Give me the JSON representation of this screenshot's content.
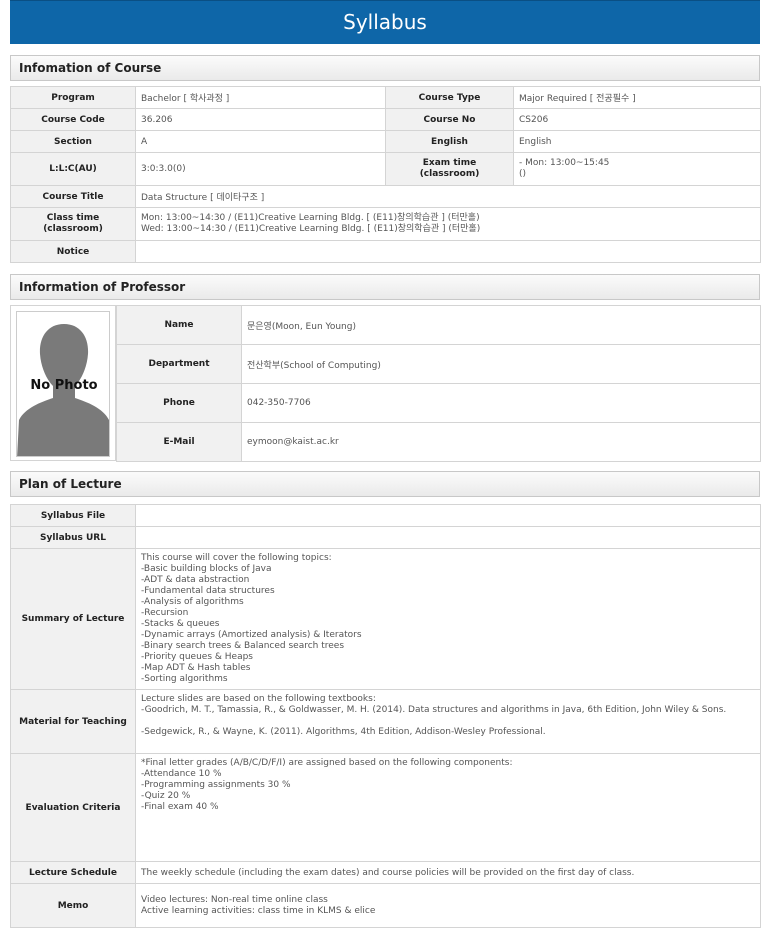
{
  "page": {
    "title": "Syllabus"
  },
  "course": {
    "heading": "Infomation of Course",
    "program_label": "Program",
    "program_value": "Bachelor [ 학사과정 ]",
    "course_type_label": "Course Type",
    "course_type_value": "Major Required [ 전공필수 ]",
    "course_code_label": "Course Code",
    "course_code_value": "36.206",
    "course_no_label": "Course No",
    "course_no_value": "CS206",
    "section_label": "Section",
    "section_value": "A",
    "english_label": "English",
    "english_value": "English",
    "lecture_label": "L:L:C(AU)",
    "lecture_value": "3:0:3.0(0)",
    "exam_label": "Exam time\n(classroom)",
    "exam_value": "- Mon: 13:00~15:45\n()",
    "course_title_label": "Course Title",
    "course_title_value": "Data Structure [ 데이타구조 ]",
    "class_time_label": "Class time\n(classroom)",
    "class_time_value": "Mon: 13:00~14:30 / (E11)Creative Learning Bldg. [ (E11)창의학습관 ] (터만홀)\nWed: 13:00~14:30 / (E11)Creative Learning Bldg. [ (E11)창의학습관 ] (터만홀)",
    "notice_label": "Notice",
    "notice_value": ""
  },
  "professor": {
    "heading": "Information of Professor",
    "photo_text": "No Photo",
    "name_label": "Name",
    "name_value": "문은영(Moon, Eun Young)",
    "department_label": "Department",
    "department_value": "전산학부(School of Computing)",
    "phone_label": "Phone",
    "phone_value": "042-350-7706",
    "email_label": "E-Mail",
    "email_value": "eymoon@kaist.ac.kr"
  },
  "plan": {
    "heading": "Plan of Lecture",
    "syllabus_file_label": "Syllabus File",
    "syllabus_file_value": "",
    "syllabus_url_label": "Syllabus URL",
    "syllabus_url_value": "",
    "summary_label": "Summary of Lecture",
    "summary_value": "This course will cover the following topics:\n-Basic building blocks of Java\n-ADT & data abstraction\n-Fundamental data structures\n-Analysis of algorithms\n-Recursion\n-Stacks & queues\n-Dynamic arrays (Amortized analysis) & Iterators\n-Binary search trees & Balanced search trees\n-Priority queues & Heaps\n-Map ADT & Hash tables\n-Sorting algorithms",
    "material_label": "Material for Teaching",
    "material_value": "Lecture slides are based on the following textbooks:\n-Goodrich, M. T., Tamassia, R., & Goldwasser, M. H. (2014). Data structures and algorithms in Java, 6th Edition, John Wiley & Sons.\n\n-Sedgewick, R., & Wayne, K. (2011). Algorithms, 4th Edition, Addison-Wesley Professional.",
    "evaluation_label": "Evaluation Criteria",
    "evaluation_value": "*Final letter grades (A/B/C/D/F/I) are assigned based on the following components:\n-Attendance 10 %\n-Programming assignments 30 %\n-Quiz 20 %\n-Final exam 40 %",
    "schedule_label": "Lecture Schedule",
    "schedule_value": "The weekly schedule (including the exam dates) and course policies will be provided on the first day of class.",
    "memo_label": "Memo",
    "memo_value": "Video lectures: Non-real time online class\nActive learning activities: class time in KLMS & elice"
  }
}
